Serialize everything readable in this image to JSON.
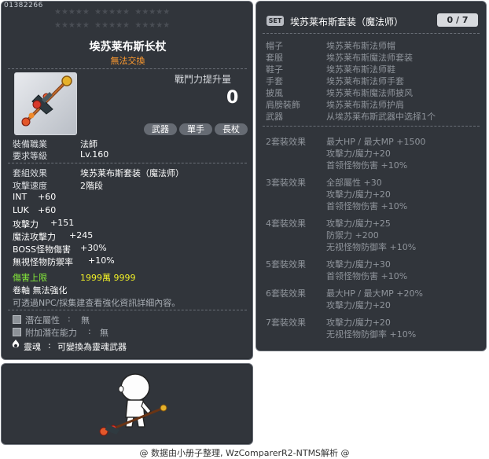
{
  "item": {
    "id": "01382266",
    "name": "埃苏莱布斯长杖",
    "trade": "無法交換",
    "power_label": "戰鬥力提升量",
    "power_value": "0",
    "tags": [
      "武器",
      "單手",
      "長杖"
    ],
    "job_label": "裝備職業",
    "job_value": "法師",
    "level_label": "要求等級",
    "level_value": "Lv.160",
    "set_label": "套組效果",
    "set_value": "埃苏莱布斯套装（魔法师）",
    "speed_label": "攻擊速度",
    "speed_value": "2階段",
    "stats": [
      {
        "label": "INT",
        "value": "+60"
      },
      {
        "label": "LUK",
        "value": "+60"
      },
      {
        "label": "攻擊力",
        "value": "+151"
      },
      {
        "label": "魔法攻擊力",
        "value": "+245"
      },
      {
        "label": "BOSS怪物傷害",
        "value": "+30%"
      },
      {
        "label": "無視怪物防禦率",
        "value": "+10%"
      }
    ],
    "damage_cap_label": "傷害上限",
    "damage_cap_value": "1999萬 9999",
    "scroll_line": "卷軸  無法強化",
    "enhance_hint": "可透過NPC/採集建查看強化資訊詳細內容。",
    "potential_label": "潛在屬性",
    "potential_value": "無",
    "add_potential_label": "附加潛在能力",
    "add_potential_value": "無",
    "soul_label": "靈魂",
    "soul_value": "可變換為靈魂武器"
  },
  "set": {
    "icon_text": "SET",
    "title": "埃苏莱布斯套装（魔法师）",
    "count": "0 / 7",
    "parts": [
      {
        "slot": "帽子",
        "name": "埃苏莱布斯法师帽"
      },
      {
        "slot": "套服",
        "name": "埃苏莱布斯魔法师套装"
      },
      {
        "slot": "鞋子",
        "name": "埃苏莱布斯法师鞋"
      },
      {
        "slot": "手套",
        "name": "埃苏莱布斯法师手套"
      },
      {
        "slot": "披風",
        "name": "埃苏莱布斯魔法师披风"
      },
      {
        "slot": "肩膀裝飾",
        "name": "埃苏莱布斯法师护肩"
      },
      {
        "slot": "武器",
        "name": "从埃苏莱布斯武器中选择1个"
      }
    ],
    "effects": [
      {
        "label": "2套裝效果",
        "lines": [
          "最大HP / 最大MP  +1500",
          "攻擊力/魔力+20",
          "首领怪物伤害  +10%"
        ]
      },
      {
        "label": "3套裝效果",
        "lines": [
          "全部屬性 +30",
          "攻擊力/魔力+20",
          "首领怪物伤害  +10%"
        ]
      },
      {
        "label": "4套裝效果",
        "lines": [
          "攻擊力/魔力+25",
          "防禦力  +200",
          "无视怪物防御率  +10%"
        ]
      },
      {
        "label": "5套裝效果",
        "lines": [
          "攻擊力/魔力+30",
          "首领怪物伤害  +10%"
        ]
      },
      {
        "label": "6套裝效果",
        "lines": [
          "最大HP / 最大MP  +20%",
          "攻擊力/魔力+20"
        ]
      },
      {
        "label": "7套裝效果",
        "lines": [
          "攻擊力/魔力+20",
          "无视怪物防御率  +10%"
        ]
      }
    ]
  },
  "footer": "@ 数据由小册子整理, WzComparerR2-NTMS解析 @",
  "colors": {
    "panel_bg": "#262a30",
    "trade_orange": "#ff9a2e",
    "damage_green": "#85ec3a",
    "damage_yellow": "#f0ef27"
  },
  "icons": [
    "staff-icon",
    "set-badge-icon",
    "soul-flame-icon",
    "potential-box-icon",
    "star-icon"
  ]
}
